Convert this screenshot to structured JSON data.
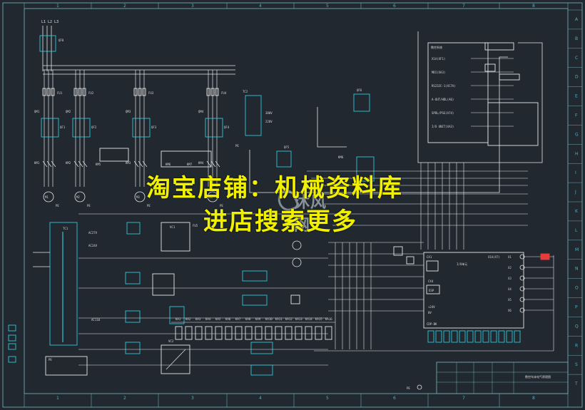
{
  "watermark": {
    "line1": "淘宝店铺：机械资料库",
    "line2": "进店搜索更多",
    "logo": "沐风网"
  },
  "ruler": {
    "top": [
      "1",
      "2",
      "3",
      "4",
      "5",
      "6",
      "7",
      "8"
    ],
    "side": [
      "A",
      "B",
      "C",
      "D",
      "E",
      "F",
      "G",
      "H",
      "I",
      "J",
      "K",
      "L",
      "M",
      "N",
      "O",
      "P",
      "Q",
      "R",
      "S",
      "T"
    ]
  },
  "labels": {
    "supply": "L1 L2 L3",
    "qf0": "QF0",
    "fu1": "FU1",
    "fu2": "FU2",
    "fu3": "FU3",
    "fu4": "FU4",
    "qm1": "QM1",
    "qm2": "QM2",
    "qm3": "QM3",
    "qm4": "QM4",
    "qf1": "QF1",
    "qf2": "QF2",
    "qf3": "QF3",
    "qf4": "QF4",
    "qf5": "QF5",
    "qf6": "QF6",
    "km1": "KM1",
    "km2": "KM2",
    "km3": "KM3",
    "km4": "KM4",
    "km5": "KM5",
    "km6": "KM6",
    "km7": "KM7",
    "m1": "M1",
    "m2": "M2",
    "m3": "M3",
    "m4": "M4",
    "pe": "PE",
    "tc1": "TC1",
    "tc2": "TC2",
    "vc1": "VC1",
    "vc2": "VC2",
    "fu5": "FU5",
    "ac27v": "AC27V",
    "ac24v": "AC24V",
    "ac110": "AC110",
    "v380": "380V",
    "v220": "220V",
    "ka": [
      "KA1",
      "KA2",
      "KA3",
      "KA4",
      "KA5",
      "KA6",
      "KA7",
      "KA8",
      "KA9",
      "KA10",
      "KA11",
      "KA12",
      "KA13",
      "KA14",
      "KA15",
      "KA16"
    ],
    "cnc_title": "数控系统",
    "cnc_x4": "X1A(X7)",
    "cnc_lines": [
      "X1A(XF1)",
      "MDI(XA3)",
      "RS232C-1(XC7A)",
      "A-OUT/HDL(A6)",
      "SPDL/PSG(A74)",
      "I/O UNIT(XA3)"
    ],
    "right_terms": [
      "X1",
      "X2",
      "X3",
      "X4",
      "X5",
      "X6"
    ],
    "io_title": "I/O单元",
    "cx1": "CX1",
    "cx4": "CX4",
    "esp": "ESP",
    "v24": "+24V",
    "v0": "0V",
    "cp": "CDP-BK",
    "title_block": "数控车床电气原理图"
  },
  "colors": {
    "bg": "#212830",
    "wire": "#e6e6e6",
    "device": "#2fc7d8",
    "frame": "#6fa8b0",
    "accent": "#e83b3b",
    "watermark": "#f0f000"
  }
}
